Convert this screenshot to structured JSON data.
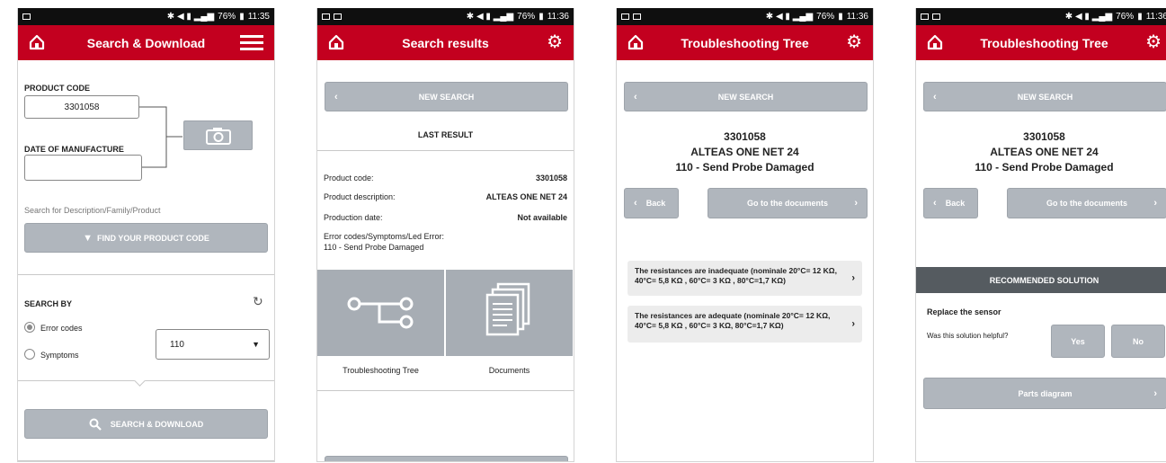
{
  "status": {
    "signal_text": "76%",
    "screens": [
      {
        "time": "11:35"
      },
      {
        "time": "11:36"
      },
      {
        "time": "11:36"
      },
      {
        "time": "11:36"
      }
    ]
  },
  "icons": {
    "home": "home-icon",
    "menu": "hamburger-menu-icon",
    "settings": "gear-icon",
    "camera": "camera-icon",
    "filter": "filter-icon",
    "search": "magnifier-icon",
    "refresh": "refresh-icon"
  },
  "colors": {
    "brand": "#c3001f",
    "button": "#b0b6bd",
    "banner": "#555b60"
  },
  "screen1": {
    "title": "Search & Download",
    "product_code_label": "PRODUCT CODE",
    "product_code_value": "3301058",
    "date_label": "DATE OF MANUFACTURE",
    "date_value": "",
    "search_hint": "Search for Description/Family/Product",
    "find_button": "FIND YOUR PRODUCT CODE",
    "search_by_label": "SEARCH BY",
    "opt_error_codes": "Error codes",
    "opt_symptoms": "Symptoms",
    "select_value": "110",
    "search_download_button": "SEARCH & DOWNLOAD"
  },
  "screen2": {
    "title": "Search results",
    "new_search": "NEW SEARCH",
    "last_result": "LAST RESULT",
    "rows": [
      {
        "label": "Product code:",
        "value": "3301058"
      },
      {
        "label": "Product description:",
        "value": "ALTEAS ONE NET 24"
      },
      {
        "label": "Production date:",
        "value": "Not available"
      }
    ],
    "error_label": "Error codes/Symptoms/Led Error:",
    "error_value": "110 - Send Probe Damaged",
    "tile_tree": "Troubleshooting Tree",
    "tile_docs": "Documents"
  },
  "screen3": {
    "title": "Troubleshooting Tree",
    "new_search": "NEW SEARCH",
    "code": "3301058",
    "product": "ALTEAS ONE NET 24",
    "error": "110 - Send Probe Damaged",
    "back": "Back",
    "go_docs": "Go to the documents",
    "options": [
      "The resistances are inadequate (nominale 20°C= 12 KΩ, 40°C= 5,8 KΩ , 60°C= 3 KΩ , 80°C=1,7 KΩ)",
      "The resistances are adequate (nominale 20°C= 12 KΩ, 40°C= 5,8 KΩ , 60°C= 3 KΩ, 80°C=1,7 KΩ)"
    ]
  },
  "screen4": {
    "title": "Troubleshooting Tree",
    "new_search": "NEW SEARCH",
    "code": "3301058",
    "product": "ALTEAS ONE NET 24",
    "error": "110 - Send Probe Damaged",
    "back": "Back",
    "go_docs": "Go to the documents",
    "recommended": "RECOMMENDED SOLUTION",
    "solution": "Replace the sensor",
    "helpful_q": "Was this solution helpful?",
    "yes": "Yes",
    "no": "No",
    "parts": "Parts diagram"
  }
}
